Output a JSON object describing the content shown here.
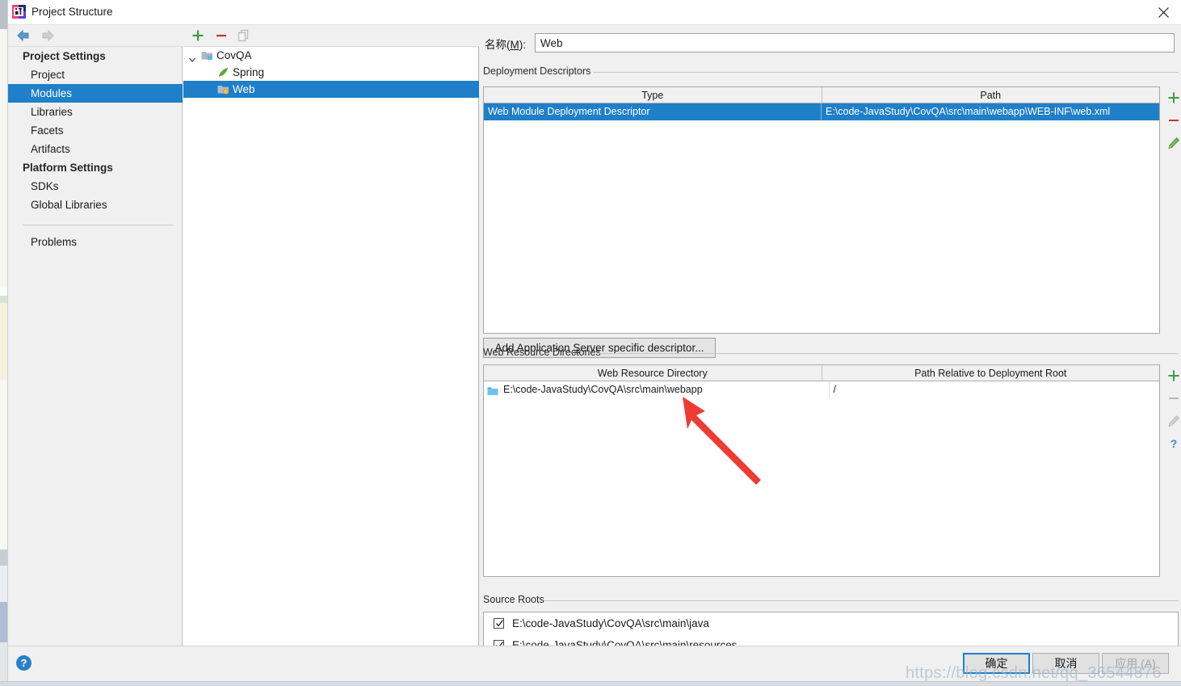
{
  "window": {
    "title": "Project Structure",
    "app_icon": "intellij-idea-logo",
    "close_icon": "close-icon"
  },
  "nav_toolbar": {
    "back_icon": "arrow-left-icon",
    "forward_icon": "arrow-right-icon"
  },
  "sidebar": {
    "groups": [
      {
        "label": "Project Settings",
        "items": [
          {
            "label": "Project",
            "selected": false
          },
          {
            "label": "Modules",
            "selected": true
          },
          {
            "label": "Libraries",
            "selected": false
          },
          {
            "label": "Facets",
            "selected": false
          },
          {
            "label": "Artifacts",
            "selected": false
          }
        ]
      },
      {
        "label": "Platform Settings",
        "items": [
          {
            "label": "SDKs",
            "selected": false
          },
          {
            "label": "Global Libraries",
            "selected": false
          }
        ]
      }
    ],
    "problems_label": "Problems"
  },
  "tree_toolbar": {
    "add_icon": "plus-icon",
    "remove_icon": "minus-icon",
    "copy_icon": "copy-icon"
  },
  "module_tree": [
    {
      "label": "CovQA",
      "icon": "module-folder-icon",
      "depth": 0,
      "expanded": true,
      "selected": false
    },
    {
      "label": "Spring",
      "icon": "spring-leaf-icon",
      "depth": 1,
      "selected": false
    },
    {
      "label": "Web",
      "icon": "web-module-icon",
      "depth": 1,
      "selected": true
    }
  ],
  "name_field": {
    "label_prefix": "名称(",
    "label_mnemonic": "M",
    "label_suffix": "):",
    "value": "Web",
    "placeholder": ""
  },
  "deployment_descriptors": {
    "group_label": "Deployment Descriptors",
    "columns": [
      "Type",
      "Path"
    ],
    "rows": [
      {
        "type": "Web Module Deployment Descriptor",
        "path": "E:\\code-JavaStudy\\CovQA\\src\\main\\webapp\\WEB-INF\\web.xml",
        "selected": true
      }
    ],
    "toolbar": [
      {
        "icon": "plus-icon",
        "state": "enabled"
      },
      {
        "icon": "minus-icon",
        "state": "enabled"
      },
      {
        "icon": "pencil-edit-icon",
        "state": "enabled"
      }
    ],
    "add_descriptor_button": {
      "prefix": "Add Application ",
      "mnemonic": "S",
      "suffix": "erver specific descriptor..."
    }
  },
  "web_resource_directories": {
    "group_label": "Web Resource Directories",
    "columns": [
      "Web Resource Directory",
      "Path Relative to Deployment Root"
    ],
    "rows": [
      {
        "directory": "E:\\code-JavaStudy\\CovQA\\src\\main\\webapp",
        "relative_path": "/",
        "icon": "folder-icon",
        "selected": false
      }
    ],
    "toolbar": [
      {
        "icon": "plus-icon",
        "state": "enabled"
      },
      {
        "icon": "minus-icon",
        "state": "disabled"
      },
      {
        "icon": "pencil-edit-icon",
        "state": "disabled"
      },
      {
        "icon": "help-question-icon",
        "state": "enabled"
      }
    ]
  },
  "source_roots": {
    "group_label": "Source Roots",
    "items": [
      {
        "label": "E:\\code-JavaStudy\\CovQA\\src\\main\\java",
        "checked": true
      },
      {
        "label": "E:\\code-JavaStudy\\CovQA\\src\\main\\resources",
        "checked": true
      }
    ]
  },
  "footer": {
    "help_icon": "help-question-icon",
    "ok_label": "确定",
    "cancel_label": "取消",
    "apply_label": "应用 (A)",
    "apply_enabled": false
  },
  "annotation": {
    "arrow_icon": "red-arrow-annotation",
    "arrow_color": "#ee3b34"
  },
  "watermark": {
    "text": "https://blog.csdn.net/qq_36544876"
  },
  "colors": {
    "selection_blue": "#1f7fc8",
    "accent_green": "#3d9c48",
    "accent_red": "#c0392b",
    "dialog_bg": "#f0f0f0",
    "panel_white": "#ffffff"
  }
}
